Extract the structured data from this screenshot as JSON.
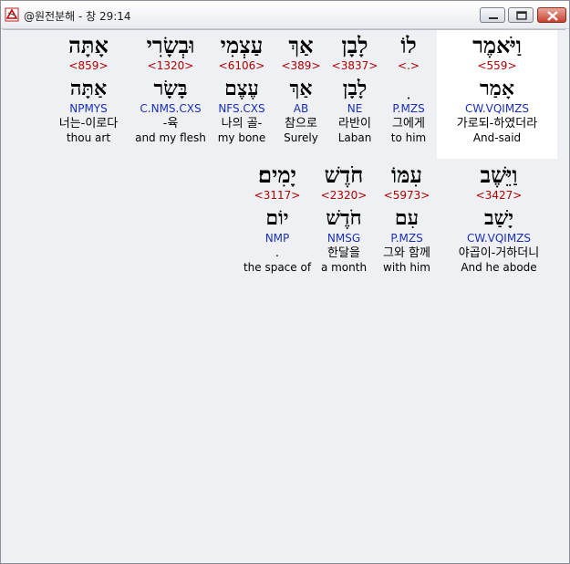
{
  "window": {
    "title": "@원전분해 - 창 29:14"
  },
  "rows": [
    {
      "words": [
        {
          "heb": "וַיֹּאמֶר",
          "strong": "<559>",
          "lemma": "אָמַר",
          "morph": "CW.VQIMZS",
          "kor": "가로되-하였더라",
          "eng": "And-said"
        },
        {
          "heb": "לוֹ",
          "strong": "<.>",
          "lemma": "ׅ",
          "morph": "P.MZS",
          "kor": "그에게",
          "eng": "to him"
        },
        {
          "heb": "לָבָן",
          "strong": "<3837>",
          "lemma": "לָבָן",
          "morph": "NE",
          "kor": "라반이",
          "eng": "Laban"
        },
        {
          "heb": "אַךְ",
          "strong": "<389>",
          "lemma": "אַךְ",
          "morph": "AB",
          "kor": "참으로",
          "eng": "Surely"
        },
        {
          "heb": "עַצְמִי",
          "strong": "<6106>",
          "lemma": "עֶצֶם",
          "morph": "NFS.CXS",
          "kor": "나의 골-",
          "eng": "my bone"
        },
        {
          "heb": "וּבְשָׂרִי",
          "strong": "<1320>",
          "lemma": "בָּשָׂר",
          "morph": "C.NMS.CXS",
          "kor": "-육",
          "eng": "and my flesh"
        },
        {
          "heb": "אָתָּה",
          "strong": "<859>",
          "lemma": "אַתָּה",
          "morph": "NPMYS",
          "kor": "너는-이로다",
          "eng": "thou art"
        }
      ]
    },
    {
      "words": [
        {
          "heb": "וַיֵּשֶׁב",
          "strong": "<3427>",
          "lemma": "יָשַׁב",
          "morph": "CW.VQIMZS",
          "kor": "야곱이-거하더니",
          "eng": "And he abode"
        },
        {
          "heb": "עִמּוֹ",
          "strong": "<5973>",
          "lemma": "עִם",
          "morph": "P.MZS",
          "kor": "그와 함께",
          "eng": "with him"
        },
        {
          "heb": "חֹדֶשׁ",
          "strong": "<2320>",
          "lemma": "חֹדֶשׁ",
          "morph": "NMSG",
          "kor": "한달을",
          "eng": "a month"
        },
        {
          "heb": "יָמִים׃",
          "strong": "<3117>",
          "lemma": "יוֹם",
          "morph": "NMP",
          "kor": ".",
          "eng": "the space of"
        }
      ]
    }
  ],
  "colors": {
    "strong": "#b00000",
    "morph": "#1a2fb8",
    "highlight": "#ffffff",
    "background": "#eef0f3"
  },
  "icons": [
    "app-icon",
    "minimize-icon",
    "maximize-icon",
    "close-icon"
  ]
}
